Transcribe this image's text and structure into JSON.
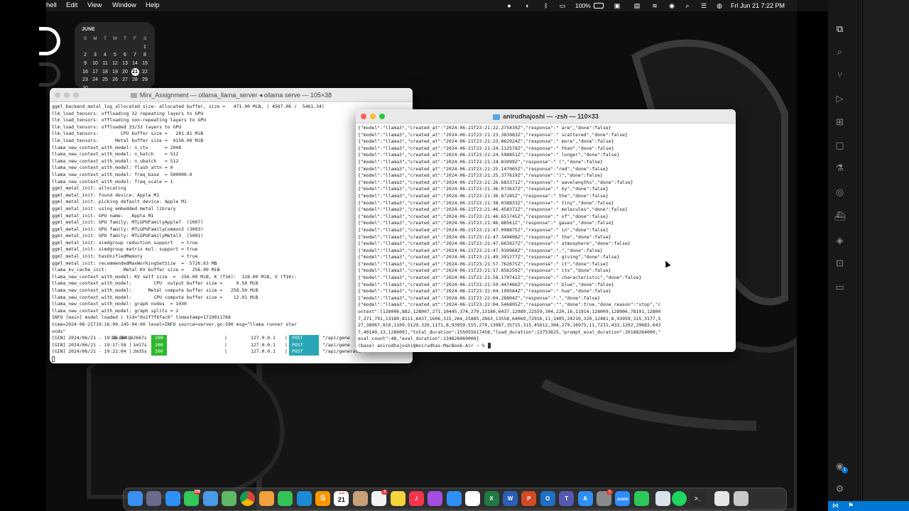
{
  "menubar": {
    "app_partial": "hell",
    "items": [
      "Edit",
      "View",
      "Window",
      "Help"
    ],
    "battery": "100%",
    "datetime": "Fri Jun 21  7:22 PM"
  },
  "calendar": {
    "month": "JUNE",
    "weekdays": [
      "S",
      "M",
      "T",
      "W",
      "T",
      "F",
      "S"
    ],
    "weeks": [
      [
        "",
        "",
        "",
        "",
        "",
        "",
        "1"
      ],
      [
        "2",
        "3",
        "4",
        "5",
        "6",
        "7",
        "8"
      ],
      [
        "9",
        "10",
        "11",
        "12",
        "13",
        "14",
        "15"
      ],
      [
        "16",
        "17",
        "18",
        "19",
        "20",
        "21",
        "22"
      ],
      [
        "23",
        "24",
        "25",
        "26",
        "27",
        "28",
        "29"
      ],
      [
        "30",
        "",
        "",
        "",
        "",
        "",
        ""
      ]
    ],
    "today": "21"
  },
  "left_terminal": {
    "title": "Mini_Assignment — ollama_llama_server ◂ ollama serve — 105×38",
    "lines": [
      "ggml_backend_metal_log_allocated_size: allocated buffer, size =   471.00 MiB, ( 4567.06 /  5461.34)",
      "llm_load_tensors: offloading 32 repeating layers to GPU",
      "llm_load_tensors: offloading non-repeating layers to GPU",
      "llm_load_tensors: offloaded 33/33 layers to GPU",
      "llm_load_tensors:        CPU buffer size =   281.81 MiB",
      "llm_load_tensors:      Metal buffer size =  4156.00 MiB",
      "llama_new_context_with_model: n_ctx      = 2048",
      "llama_new_context_with_model: n_batch    = 512",
      "llama_new_context_with_model: n_ubatch   = 512",
      "llama_new_context_with_model: flash_attn = 0",
      "llama_new_context_with_model: freq_base  = 500000.0",
      "llama_new_context_with_model: freq_scale = 1",
      "ggml_metal_init: allocating",
      "ggml_metal_init: found device: Apple M1",
      "ggml_metal_init: picking default device: Apple M1",
      "ggml_metal_init: using embedded metal library",
      "ggml_metal_init: GPU name:   Apple M1",
      "ggml_metal_init: GPU family: MTLGPUFamilyApple7  (1007)",
      "ggml_metal_init: GPU family: MTLGPUFamilyCommon3 (3003)",
      "ggml_metal_init: GPU family: MTLGPUFamilyMetal3  (5001)",
      "ggml_metal_init: simdgroup reduction support   = true",
      "ggml_metal_init: simdgroup matrix mul. support = true",
      "ggml_metal_init: hasUnifiedMemory              = true",
      "ggml_metal_init: recommendedMaxWorkingSetSize  =  5726.63 MB",
      "llama_kv_cache_init:      Metal KV buffer size =   256.00 MiB",
      "llama_new_context_with_model: KV self size  =  256.00 MiB, K (f16):  128.00 MiB, V (f16):",
      "llama_new_context_with_model:        CPU  output buffer size =     0.50 MiB",
      "llama_new_context_with_model:      Metal compute buffer size =   258.50 MiB",
      "llama_new_context_with_model:        CPU compute buffer size =    12.01 MiB",
      "llama_new_context_with_model: graph nodes  = 1030",
      "llama_new_context_with_model: graph splits = 2",
      "INFO [main] model loaded | tid=\"0x1f7f6fac0\" timestamp=1719011768",
      "time=2024-06-21T19:16:09.245-04:00 level=INFO source=server.go:590 msg=\"llama runner star",
      "onds\""
    ],
    "gin": [
      {
        "date": "[GIN] 2024/06/21 - 19:16:14 |",
        "status": "200",
        "latency": "18.884142667s",
        "ip": "127.0.0.1",
        "method": "POST",
        "path": "\"/api/gene"
      },
      {
        "date": "[GIN] 2024/06/21 - 19:17:58 |",
        "status": "200",
        "latency": "1m17s",
        "ip": "127.0.0.1",
        "method": "POST",
        "path": "\"/api/gene"
      },
      {
        "date": "[GIN] 2024/06/21 - 19:22:04 |",
        "status": "200",
        "latency": "2m35s",
        "ip": "127.0.0.1",
        "method": "POST",
        "path": "\"/api/generate\""
      }
    ]
  },
  "right_terminal": {
    "title": "anirudhajoshi — -zsh — 110×33",
    "lines": [
      "{\"model\":\"llama3\",\"created_at\":\"2024-06-21T23:21:22.275439Z\",\"response\":\" are\",\"done\":false}",
      "{\"model\":\"llama3\",\"created_at\":\"2024-06-21T23:21:23.383983Z\",\"response\":\" scattered\",\"done\":false}",
      "{\"model\":\"llama3\",\"created_at\":\"2024-06-21T23:21:23.862924Z\",\"response\":\" more\",\"done\":false}",
      "{\"model\":\"llama3\",\"created_at\":\"2024-06-21T23:21:24.112578Z\",\"response\":\" than\",\"done\":false}",
      "{\"model\":\"llama3\",\"created_at\":\"2024-06-21T23:21:24.598851Z\",\"response\":\" longer\",\"done\":false}",
      "{\"model\":\"llama3\",\"created_at\":\"2024-06-21T23:21:24.83099Z\",\"response\":\" (\",\"done\":false}",
      "{\"model\":\"llama3\",\"created_at\":\"2024-06-21T23:21:25.147065Z\",\"response\":\"red\",\"done\":false}",
      "{\"model\":\"llama3\",\"created_at\":\"2024-06-21T23:21:25.377619Z\",\"response\":\")\",\"done\":false}",
      "{\"model\":\"llama3\",\"created_at\":\"2024-06-21T23:21:26.683371Z\",\"response\":\" wavelengths\",\"done\":false}",
      "{\"model\":\"llama3\",\"created_at\":\"2024-06-21T23:21:36.073637Z\",\"response\":\" by\",\"done\":false}",
      "{\"model\":\"llama3\",\"created_at\":\"2024-06-21T23:21:36.87285Z\",\"response\":\" the\",\"done\":false}",
      "{\"model\":\"llama3\",\"created_at\":\"2024-06-21T23:21:38.038833Z\",\"response\":\" tiny\",\"done\":false}",
      "{\"model\":\"llama3\",\"created_at\":\"2024-06-21T23:21:46.458372Z\",\"response\":\" molecules\",\"done\":false}",
      "{\"model\":\"llama3\",\"created_at\":\"2024-06-21T23:21:46.651745Z\",\"response\":\" of\",\"done\":false}",
      "{\"model\":\"llama3\",\"created_at\":\"2024-06-21T23:21:46.88561Z\",\"response\":\" gases\",\"done\":false}",
      "{\"model\":\"llama3\",\"created_at\":\"2024-06-21T23:21:47.098875Z\",\"response\":\" in\",\"done\":false}",
      "{\"model\":\"llama3\",\"created_at\":\"2024-06-21T23:21:47.349408Z\",\"response\":\" the\",\"done\":false}",
      "{\"model\":\"llama3\",\"created_at\":\"2024-06-21T23:21:47.663927Z\",\"response\":\" atmosphere\",\"done\":false}",
      "{\"model\":\"llama3\",\"created_at\":\"2024-06-21T23:21:47.939968Z\",\"response\":\",\",\"done\":false}",
      "{\"model\":\"llama3\",\"created_at\":\"2024-06-21T23:21:49.391277Z\",\"response\":\" giving\",\"done\":false}",
      "{\"model\":\"llama3\",\"created_at\":\"2024-06-21T23:21:57.762675Z\",\"response\":\" it\",\"done\":false}",
      "{\"model\":\"llama3\",\"created_at\":\"2024-06-21T23:21:57.856259Z\",\"response\":\" its\",\"done\":false}",
      "{\"model\":\"llama3\",\"created_at\":\"2024-06-21T23:21:58.179742Z\",\"response\":\" characteristic\",\"done\":false}",
      "{\"model\":\"llama3\",\"created_at\":\"2024-06-21T23:21:59.447466Z\",\"response\":\" blue\",\"done\":false}",
      "{\"model\":\"llama3\",\"created_at\":\"2024-06-21T23:22:04.199584Z\",\"response\":\" hue\",\"done\":false}",
      "{\"model\":\"llama3\",\"created_at\":\"2024-06-21T23:22:04.28804Z\",\"response\":\".\",\"done\":false}",
      "{\"model\":\"llama3\",\"created_at\":\"2024-06-21T23:22:04.546895Z\",\"response\":\"\",\"done\":true,\"done_reason\":\"stop\",\"c",
      "ontext\":[128006,882,128007,271,10445,374,279,13180,6437,12989,22559,304,220,16,11914,128009,128006,78191,12800",
      "7,271,791,13180,8111,6437,1606,315,264,25885,2663,13558,64069,72916,11,1405,24210,320,12481,8,93959,315,3177,5",
      "27,38067,810,1109,5129,320,1171,8,93959,555,279,13987,35715,315,45612,304,279,16975,11,7231,433,1202,29683,643",
      "7,40140,13,128009],\"total_duration\":155055617458,\"load_duration\":13753625,\"prompt_eval_duration\":20188264000,\"",
      "eval_count\":48,\"eval_duration\":134826069000}",
      "(base) anirudhajoshi@Anirudhas-MacBook-Air ~ % "
    ]
  },
  "dock": {
    "apps": [
      {
        "name": "finder",
        "color": "#3b8ff0",
        "glyph": ""
      },
      {
        "name": "launchpad",
        "color": "#6b6b8f",
        "glyph": ""
      },
      {
        "name": "safari",
        "color": "#2f8ff5",
        "glyph": ""
      },
      {
        "name": "messages",
        "color": "#32c85a",
        "glyph": "",
        "badge": "199"
      },
      {
        "name": "mail",
        "color": "#4a9ae8",
        "glyph": ""
      },
      {
        "name": "maps",
        "color": "#5fb865",
        "glyph": ""
      },
      {
        "name": "chrome",
        "color": "#e8e8e8",
        "glyph": ""
      },
      {
        "name": "photos",
        "color": "#f0a03c",
        "glyph": ""
      },
      {
        "name": "facetime",
        "color": "#33c257",
        "glyph": ""
      },
      {
        "name": "vscode",
        "color": "#1d8ad6",
        "glyph": ""
      },
      {
        "name": "sublime",
        "color": "#ff9800",
        "glyph": "S"
      },
      {
        "name": "calendar",
        "color": "#ffffff",
        "glyph": "21",
        "sub": "JUN"
      },
      {
        "name": "contacts",
        "color": "#c9a07a",
        "glyph": ""
      },
      {
        "name": "reminders",
        "color": "#f2f2f2",
        "glyph": "",
        "badge": "2"
      },
      {
        "name": "notes",
        "color": "#f5d33d",
        "glyph": ""
      },
      {
        "name": "music",
        "color": "#f2364d",
        "glyph": "♪"
      },
      {
        "name": "podcasts",
        "color": "#a44de0",
        "glyph": ""
      },
      {
        "name": "keynote",
        "color": "#2f8ff5",
        "glyph": ""
      },
      {
        "name": "slack",
        "color": "#ffffff",
        "glyph": ""
      },
      {
        "name": "excel",
        "color": "#1f7a43",
        "glyph": "X"
      },
      {
        "name": "word",
        "color": "#2b5fb5",
        "glyph": "W"
      },
      {
        "name": "powerpoint",
        "color": "#d24a26",
        "glyph": "P"
      },
      {
        "name": "outlook",
        "color": "#1f6fc7",
        "glyph": "O"
      },
      {
        "name": "teams",
        "color": "#5558af",
        "glyph": "T"
      },
      {
        "name": "app-store",
        "color": "#2f8ff5",
        "glyph": "A"
      },
      {
        "name": "system-settings",
        "color": "#8a8a8a",
        "glyph": "",
        "badge": "1"
      },
      {
        "name": "zoom",
        "color": "#2d8cff",
        "glyph": "zoom"
      },
      {
        "name": "whatsapp",
        "color": "#2cc85a",
        "glyph": ""
      },
      {
        "name": "preview",
        "color": "#d9e3ec",
        "glyph": ""
      },
      {
        "name": "spotify",
        "color": "#1ed760",
        "glyph": ""
      },
      {
        "name": "terminal",
        "color": "#2a2a2a",
        "glyph": ">_"
      },
      {
        "name": "documents-folder",
        "color": "#e6e6e6",
        "glyph": ""
      },
      {
        "name": "trash",
        "color": "#c8c8c8",
        "glyph": ""
      }
    ]
  },
  "vscode": {
    "icons": [
      "files-icon",
      "search-icon",
      "source-control-icon",
      "run-debug-icon",
      "extensions-icon",
      "remote-explorer-icon",
      "testing-icon",
      "github-icon",
      "docker-icon",
      "git-graph-icon",
      "jupyter-icon",
      "chat-icon",
      "account-icon",
      "settings-gear-icon"
    ],
    "account_badge": "1"
  },
  "colors": {
    "status_200": "#2db82d",
    "method_post": "#29a6b5",
    "vscode_status": "#0078d4"
  }
}
